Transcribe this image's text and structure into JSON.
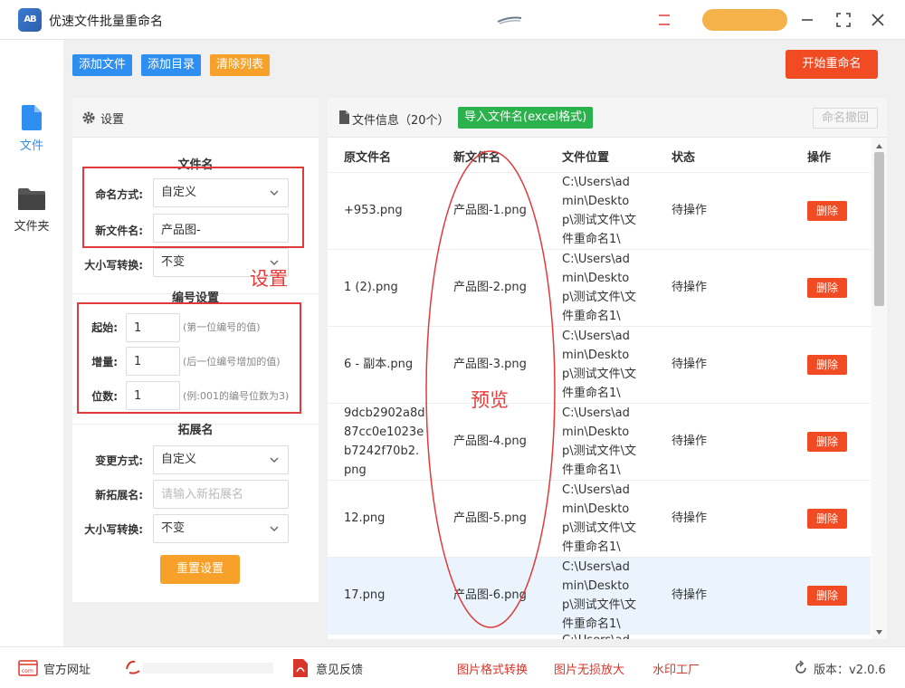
{
  "app": {
    "title": "优速文件批量重命名"
  },
  "nav": {
    "files_label": "文件",
    "folder_label": "文件夹"
  },
  "toolbar": {
    "add_file": "添加文件",
    "add_dir": "添加目录",
    "clear_list": "清除列表",
    "start_rename": "开始重命名"
  },
  "settings": {
    "title": "设置",
    "filename_section": "文件名",
    "naming_mode_label": "命名方式:",
    "naming_mode_value": "自定义",
    "new_name_label": "新文件名:",
    "new_name_value": "产品图-",
    "case_label": "大小写转换:",
    "case_value": "不变",
    "number_section": "编号设置",
    "start_label": "起始:",
    "start_value": "1",
    "start_hint": "(第一位编号的值)",
    "step_label": "增量:",
    "step_value": "1",
    "step_hint": "(后一位编号增加的值)",
    "digits_label": "位数:",
    "digits_value": "1",
    "digits_hint": "(例:001的编号位数为3)",
    "ext_section": "拓展名",
    "ext_mode_label": "变更方式:",
    "ext_mode_value": "自定义",
    "new_ext_label": "新拓展名:",
    "new_ext_placeholder": "请输入新拓展名",
    "ext_case_label": "大小写转换:",
    "ext_case_value": "不变",
    "reset": "重置设置"
  },
  "annotations": {
    "settings": "设置",
    "preview": "预览"
  },
  "fileinfo": {
    "title": "文件信息（20个）",
    "import_btn": "导入文件名(excel格式)",
    "undo_btn": "命名撤回",
    "columns": [
      "原文件名",
      "新文件名",
      "文件位置",
      "状态",
      "操作"
    ],
    "rows": [
      {
        "orig": "+953.png",
        "new": "产品图-1.png",
        "loc": "C:\\Users\\admin\\Desktop\\测试文件\\文件重命名1\\",
        "status": "待操作",
        "action": "删除"
      },
      {
        "orig": "1 (2).png",
        "new": "产品图-2.png",
        "loc": "C:\\Users\\admin\\Desktop\\测试文件\\文件重命名1\\",
        "status": "待操作",
        "action": "删除"
      },
      {
        "orig": "6 - 副本.png",
        "new": "产品图-3.png",
        "loc": "C:\\Users\\admin\\Desktop\\测试文件\\文件重命名1\\",
        "status": "待操作",
        "action": "删除"
      },
      {
        "orig": "9dcb2902a8d87cc0e1023eb7242f70b2.png",
        "new": "产品图-4.png",
        "loc": "C:\\Users\\admin\\Desktop\\测试文件\\文件重命名1\\",
        "status": "待操作",
        "action": "删除"
      },
      {
        "orig": "12.png",
        "new": "产品图-5.png",
        "loc": "C:\\Users\\admin\\Desktop\\测试文件\\文件重命名1\\",
        "status": "待操作",
        "action": "删除"
      },
      {
        "orig": "17.png",
        "new": "产品图-6.png",
        "loc": "C:\\Users\\admin\\Desktop\\测试文件\\文件重命名1\\",
        "status": "待操作",
        "action": "删除"
      }
    ],
    "partial_row_loc": "C:\\Users\\ad"
  },
  "footer": {
    "website": "官方网址",
    "feedback": "意见反馈",
    "img_convert": "图片格式转换",
    "img_enlarge": "图片无损放大",
    "watermark": "水印工厂",
    "version": "版本：v2.0.6"
  },
  "colors": {
    "primary_blue": "#2f8ff0",
    "orange": "#f7a12a",
    "red_action": "#f04b23",
    "green": "#2bb24c",
    "annotation_red": "#e03b3b"
  }
}
